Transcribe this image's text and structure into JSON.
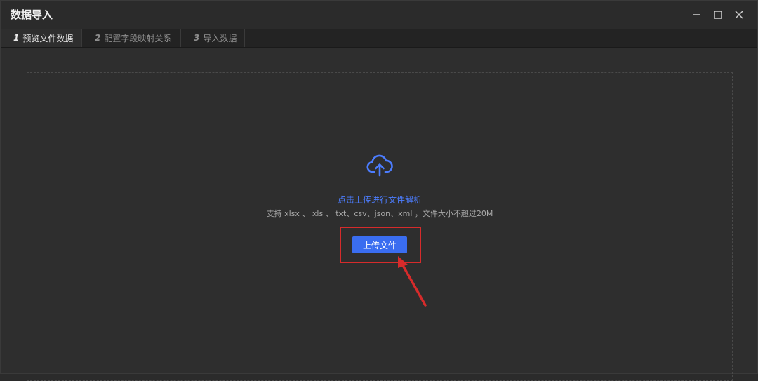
{
  "window": {
    "title": "数据导入"
  },
  "tabs": [
    {
      "num": "1",
      "label": "预览文件数据",
      "active": true
    },
    {
      "num": "2",
      "label": "配置字段映射关系",
      "active": false
    },
    {
      "num": "3",
      "label": "导入数据",
      "active": false
    }
  ],
  "upload": {
    "icon": "cloud-upload-icon",
    "hint_main": "点击上传进行文件解析",
    "hint_sub": "支持 xlsx 、 xls 、 txt、csv、json、xml ，文件大小不超过20M",
    "button_label": "上传文件"
  },
  "colors": {
    "accent": "#3a6df0",
    "link": "#4c7dff",
    "annotation": "#d62b2b"
  }
}
